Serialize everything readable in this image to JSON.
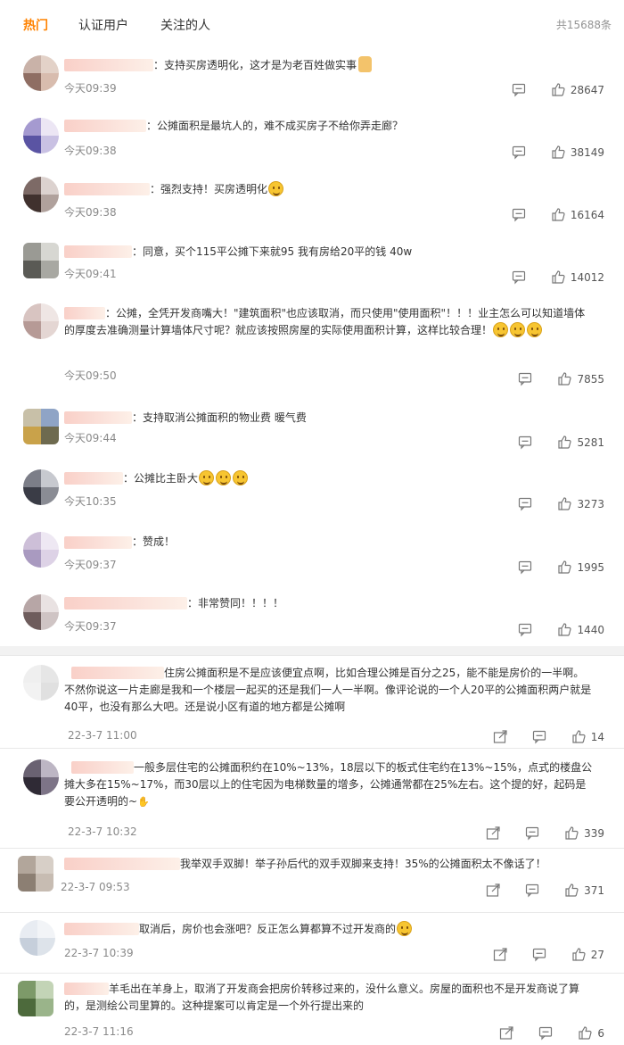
{
  "tabs": [
    {
      "label": "热门"
    },
    {
      "label": "认证用户"
    },
    {
      "label": "关注的人"
    }
  ],
  "total_count": "共15688条",
  "comments": [
    {
      "text": "：支持买房透明化，这才是为老百姓做实事",
      "time": "今天09:39",
      "likes": "28647"
    },
    {
      "text": "：公摊面积是最坑人的，难不成买房子不给你弄走廊？",
      "time": "今天09:38",
      "likes": "38149"
    },
    {
      "text": "：强烈支持！买房透明化",
      "time": "今天09:38",
      "likes": "16164"
    },
    {
      "text": "：同意，买个115平公摊下来就95 我有房给20平的钱 40w",
      "time": "今天09:41",
      "likes": "14012"
    },
    {
      "text": "：公摊，全凭开发商嘴大！\"建筑面积\"也应该取消，而只使用\"使用面积\"！！！业主怎么可以知道墙体的厚度去准确测量计算墙体尺寸呢？就应该按照房屋的实际使用面积计算，这样比较合理！",
      "time": "今天09:50",
      "likes": "7855"
    },
    {
      "text": "：支持取消公摊面积的物业费 暖气费",
      "time": "今天09:44",
      "likes": "5281"
    },
    {
      "text": "：公摊比主卧大",
      "time": "今天10:35",
      "likes": "3273"
    },
    {
      "text": "：赞成！",
      "time": "今天09:37",
      "likes": "1995"
    },
    {
      "text": "：非常赞同！！！！",
      "time": "今天09:37",
      "likes": "1440"
    }
  ],
  "replies": [
    {
      "text": "住房公摊面积是不是应该便宜点啊，比如合理公摊是百分之25，能不能是房价的一半啊。不然你说这一片走廊是我和一个楼层一起买的还是我们一人一半啊。像评论说的一个人20平的公摊面积两户就是40平，也没有那么大吧。还是说小区有道的地方都是公摊啊",
      "time": "22-3-7 11:00",
      "likes": "14"
    },
    {
      "text": "一般多层住宅的公摊面积约在10%~13%，18层以下的板式住宅约在13%~15%，点式的楼盘公摊大多在15%~17%，而30层以上的住宅因为电梯数量的增多，公摊通常都在25%左右。这个提的好，起码是要公开透明的~",
      "time": "22-3-7 10:32",
      "likes": "339"
    },
    {
      "text": "我举双手双脚！举子孙后代的双手双脚来支持！35%的公摊面积太不像话了！",
      "time": "22-3-7 09:53",
      "likes": "371"
    },
    {
      "text": "取消后，房价也会涨吧？反正怎么算都算不过开发商的",
      "time": "22-3-7 10:39",
      "likes": "27"
    },
    {
      "text": "羊毛出在羊身上，取消了开发商会把房价转移过来的，没什么意义。房屋的面积也不是开发商说了算的，是测绘公司里算的。这种提案可以肯定是一个外行提出来的",
      "time": "22-3-7 11:16",
      "likes": "6"
    }
  ],
  "icons": {
    "comment": "comment-icon",
    "like": "like-icon",
    "share": "share-icon"
  },
  "colors": {
    "active_tab": "#ff8200",
    "meta": "#8a8a8a",
    "separator": "#f2f2f2"
  }
}
